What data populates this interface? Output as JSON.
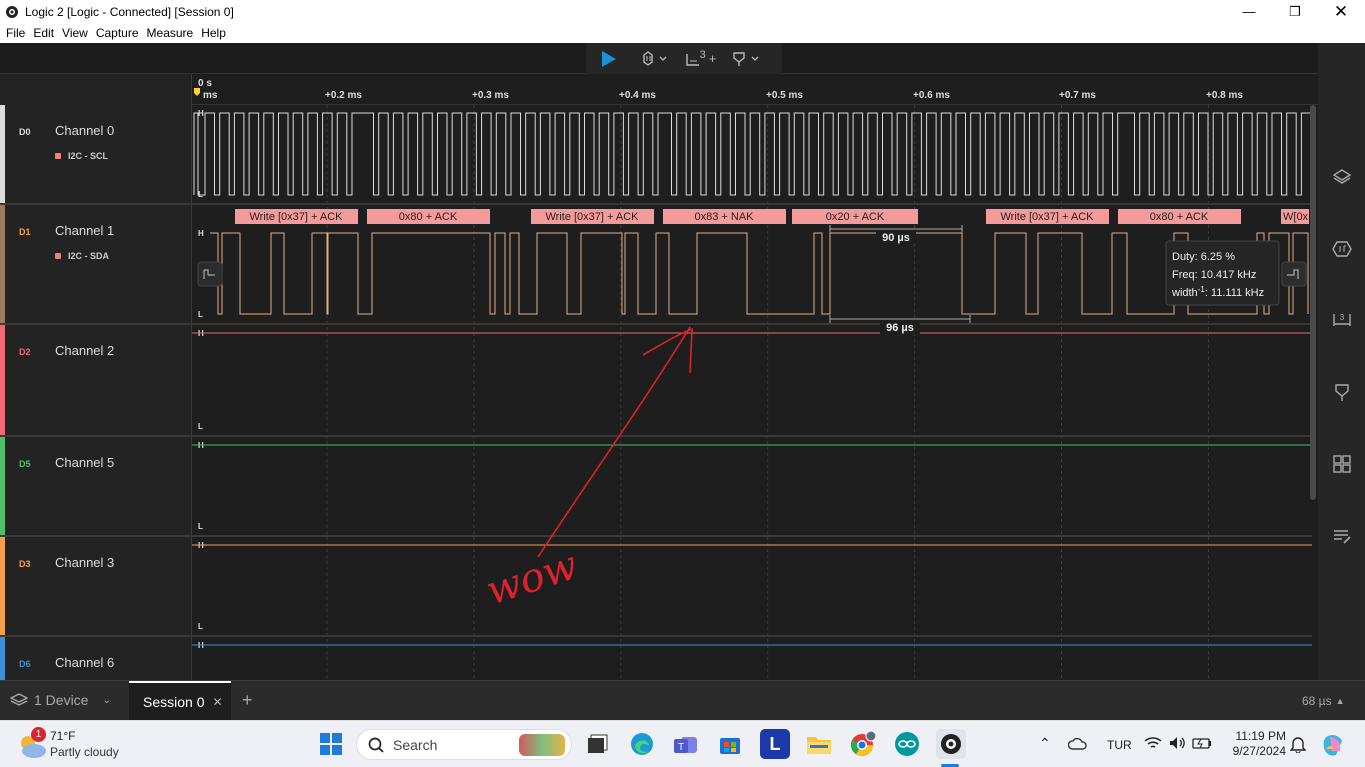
{
  "window": {
    "title": "Logic 2 [Logic - Connected] [Session 0]"
  },
  "menu": [
    "File",
    "Edit",
    "View",
    "Capture",
    "Measure",
    "Help"
  ],
  "toolbar": {
    "trigger_count": "3"
  },
  "ruler": {
    "start_label": "0 s",
    "start_unit": "ms",
    "ticks": [
      "+0.2 ms",
      "+0.3 ms",
      "+0.4 ms",
      "+0.5 ms",
      "+0.6 ms",
      "+0.7 ms",
      "+0.8 ms"
    ]
  },
  "channels": [
    {
      "tag": "D0",
      "name": "Channel 0",
      "analyzer": "I2C - SCL",
      "color": "#dcdcdc"
    },
    {
      "tag": "D1",
      "name": "Channel 1",
      "analyzer": "I2C - SDA",
      "color": "#a07860"
    },
    {
      "tag": "D2",
      "name": "Channel 2",
      "color": "#ef6a74"
    },
    {
      "tag": "D5",
      "name": "Channel 5",
      "color": "#4fbf6a"
    },
    {
      "tag": "D3",
      "name": "Channel 3",
      "color": "#f5a04a"
    },
    {
      "tag": "D6",
      "name": "Channel 6",
      "color": "#3f8fd6"
    }
  ],
  "levels": {
    "high": "H",
    "low": "L"
  },
  "decodes": [
    "Write [0x37] + ACK",
    "0x80 + ACK",
    "Write [0x37] + ACK",
    "0x83 + NAK",
    "0x20 + ACK",
    "Write [0x37] + ACK",
    "0x80 + ACK",
    "W[0x"
  ],
  "measurements": {
    "pulse_width": "90 µs",
    "period": "96 µs"
  },
  "tooltip": {
    "duty": "Duty: 6.25 %",
    "freq": "Freq: 10.417 kHz",
    "width_label": "width",
    "width_sup": "-1",
    "width_value": ": 11.111 kHz"
  },
  "annotation": {
    "text": "wow",
    "color": "#e0202a"
  },
  "session": {
    "devices": "1 Device",
    "tab": "Session 0",
    "timing": "68 µs"
  },
  "taskbar": {
    "weather_temp": "71°F",
    "weather_desc": "Partly cloudy",
    "weather_badge": "1",
    "search": "Search",
    "lang": "TUR",
    "time": "11:19 PM",
    "date": "9/27/2024",
    "l_app": "L"
  },
  "colors": {
    "accent": "#1e90d6",
    "decode_bg": "#f59a9a",
    "scl": "#dcdcdc",
    "sda": "#e2b08a"
  }
}
